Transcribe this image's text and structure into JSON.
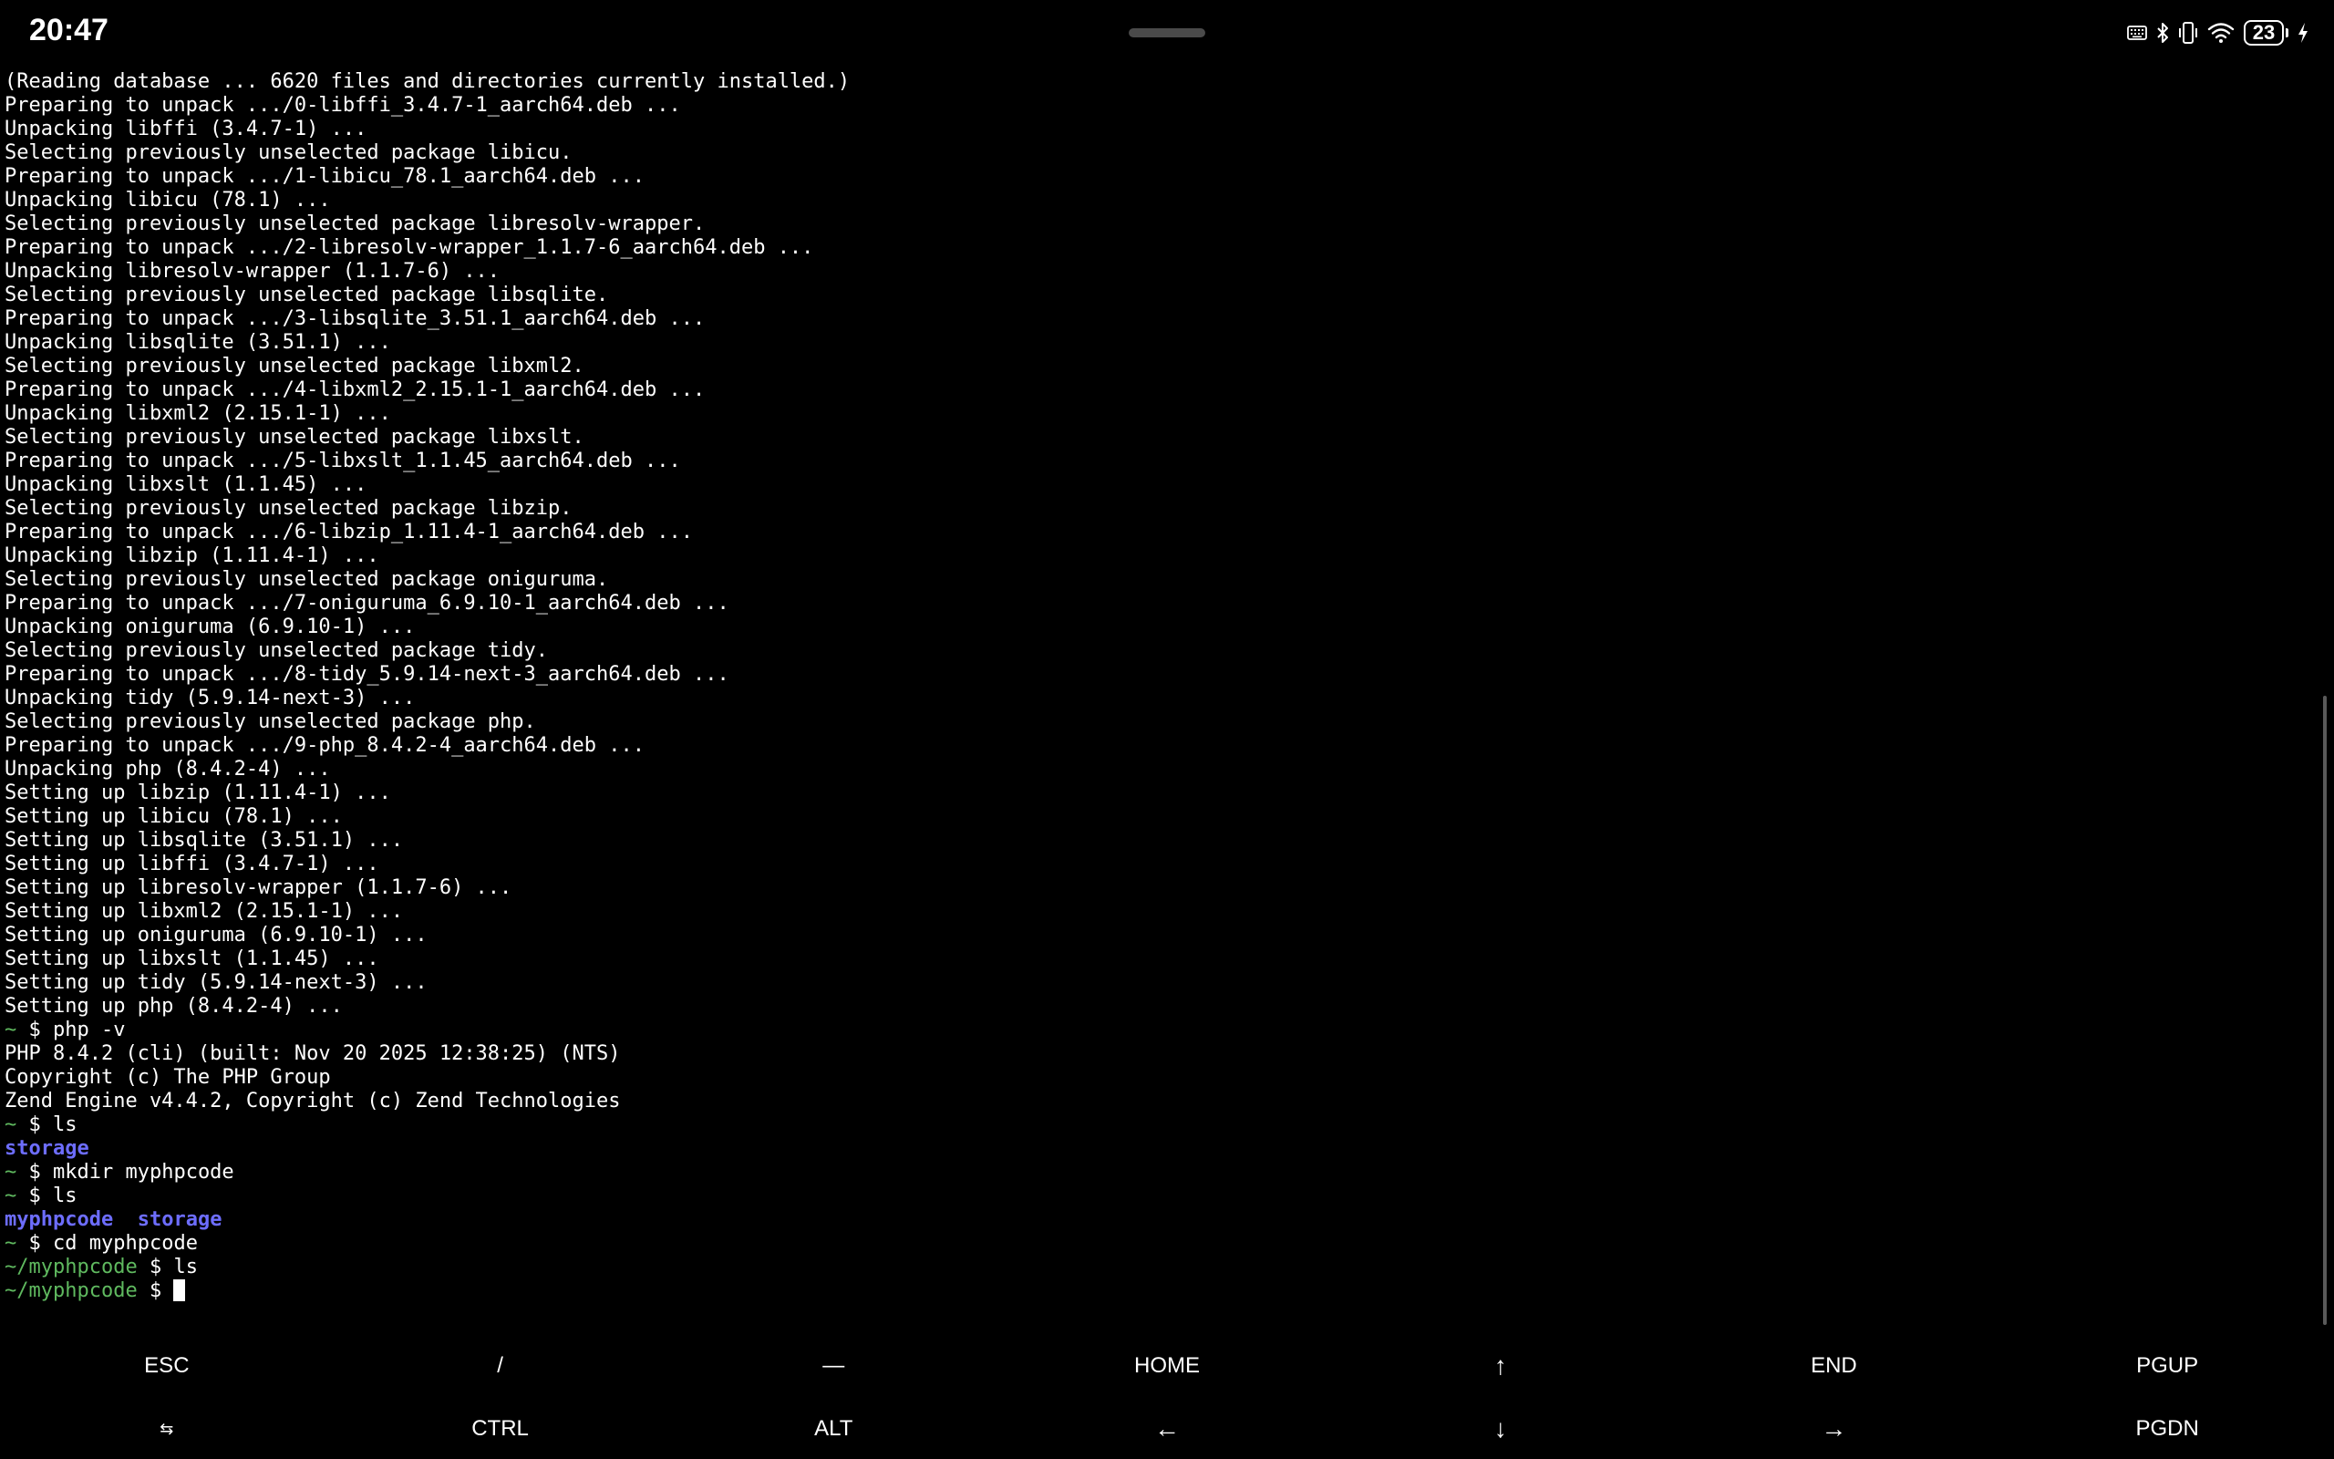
{
  "status_bar": {
    "time": "20:47",
    "battery_level": "23",
    "icons": [
      "keyboard-icon",
      "bluetooth-icon",
      "vibrate-icon",
      "wifi-icon",
      "battery-icon",
      "charging-icon"
    ]
  },
  "terminal": {
    "lines": [
      {
        "text": "(Reading database ... 6620 files and directories currently installed.)"
      },
      {
        "text": "Preparing to unpack .../0-libffi_3.4.7-1_aarch64.deb ..."
      },
      {
        "text": "Unpacking libffi (3.4.7-1) ..."
      },
      {
        "text": "Selecting previously unselected package libicu."
      },
      {
        "text": "Preparing to unpack .../1-libicu_78.1_aarch64.deb ..."
      },
      {
        "text": "Unpacking libicu (78.1) ..."
      },
      {
        "text": "Selecting previously unselected package libresolv-wrapper."
      },
      {
        "text": "Preparing to unpack .../2-libresolv-wrapper_1.1.7-6_aarch64.deb ..."
      },
      {
        "text": "Unpacking libresolv-wrapper (1.1.7-6) ..."
      },
      {
        "text": "Selecting previously unselected package libsqlite."
      },
      {
        "text": "Preparing to unpack .../3-libsqlite_3.51.1_aarch64.deb ..."
      },
      {
        "text": "Unpacking libsqlite (3.51.1) ..."
      },
      {
        "text": "Selecting previously unselected package libxml2."
      },
      {
        "text": "Preparing to unpack .../4-libxml2_2.15.1-1_aarch64.deb ..."
      },
      {
        "text": "Unpacking libxml2 (2.15.1-1) ..."
      },
      {
        "text": "Selecting previously unselected package libxslt."
      },
      {
        "text": "Preparing to unpack .../5-libxslt_1.1.45_aarch64.deb ..."
      },
      {
        "text": "Unpacking libxslt (1.1.45) ..."
      },
      {
        "text": "Selecting previously unselected package libzip."
      },
      {
        "text": "Preparing to unpack .../6-libzip_1.11.4-1_aarch64.deb ..."
      },
      {
        "text": "Unpacking libzip (1.11.4-1) ..."
      },
      {
        "text": "Selecting previously unselected package oniguruma."
      },
      {
        "text": "Preparing to unpack .../7-oniguruma_6.9.10-1_aarch64.deb ..."
      },
      {
        "text": "Unpacking oniguruma (6.9.10-1) ..."
      },
      {
        "text": "Selecting previously unselected package tidy."
      },
      {
        "text": "Preparing to unpack .../8-tidy_5.9.14-next-3_aarch64.deb ..."
      },
      {
        "text": "Unpacking tidy (5.9.14-next-3) ..."
      },
      {
        "text": "Selecting previously unselected package php."
      },
      {
        "text": "Preparing to unpack .../9-php_8.4.2-4_aarch64.deb ..."
      },
      {
        "text": "Unpacking php (8.4.2-4) ..."
      },
      {
        "text": "Setting up libzip (1.11.4-1) ..."
      },
      {
        "text": "Setting up libicu (78.1) ..."
      },
      {
        "text": "Setting up libsqlite (3.51.1) ..."
      },
      {
        "text": "Setting up libffi (3.4.7-1) ..."
      },
      {
        "text": "Setting up libresolv-wrapper (1.1.7-6) ..."
      },
      {
        "text": "Setting up libxml2 (2.15.1-1) ..."
      },
      {
        "text": "Setting up oniguruma (6.9.10-1) ..."
      },
      {
        "text": "Setting up libxslt (1.1.45) ..."
      },
      {
        "text": "Setting up tidy (5.9.14-next-3) ..."
      },
      {
        "text": "Setting up php (8.4.2-4) ..."
      },
      {
        "prompt": "~",
        "cmd": "php -v"
      },
      {
        "text": "PHP 8.4.2 (cli) (built: Nov 20 2025 12:38:25) (NTS)"
      },
      {
        "text": "Copyright (c) The PHP Group"
      },
      {
        "text": "Zend Engine v4.4.2, Copyright (c) Zend Technologies"
      },
      {
        "prompt": "~",
        "cmd": "ls"
      },
      {
        "dirs": [
          "storage"
        ]
      },
      {
        "prompt": "~",
        "cmd": "mkdir myphpcode"
      },
      {
        "prompt": "~",
        "cmd": "ls"
      },
      {
        "dirs": [
          "myphpcode",
          "storage"
        ]
      },
      {
        "prompt": "~",
        "cmd": "cd myphpcode"
      },
      {
        "prompt": "~/myphpcode",
        "cmd": "ls"
      },
      {
        "prompt": "~/myphpcode",
        "cmd": "",
        "cursor": true
      }
    ]
  },
  "extra_keys": {
    "row1": [
      {
        "label": "ESC",
        "name": "esc-key"
      },
      {
        "label": "/",
        "name": "slash-key"
      },
      {
        "label": "—",
        "name": "dash-key"
      },
      {
        "label": "HOME",
        "name": "home-key"
      },
      {
        "label": "↑",
        "name": "up-arrow-key"
      },
      {
        "label": "END",
        "name": "end-key"
      },
      {
        "label": "PGUP",
        "name": "pgup-key"
      }
    ],
    "row2": [
      {
        "label": "⇆",
        "name": "tab-key"
      },
      {
        "label": "CTRL",
        "name": "ctrl-key"
      },
      {
        "label": "ALT",
        "name": "alt-key"
      },
      {
        "label": "←",
        "name": "left-arrow-key"
      },
      {
        "label": "↓",
        "name": "down-arrow-key"
      },
      {
        "label": "→",
        "name": "right-arrow-key"
      },
      {
        "label": "PGDN",
        "name": "pgdn-key"
      }
    ]
  }
}
